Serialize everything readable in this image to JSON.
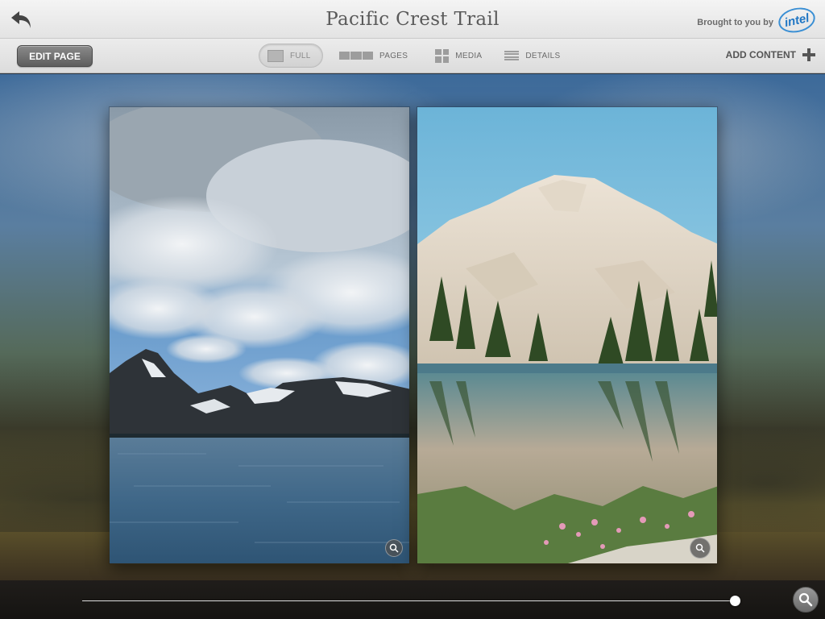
{
  "app": {
    "title": "Pacific Crest Trail",
    "sponsor_text": "Brought to you by",
    "sponsor_logo_text": "intel",
    "back_icon": "back-arrow-icon"
  },
  "toolbar": {
    "edit_label": "EDIT PAGE",
    "views": [
      {
        "label": "FULL",
        "icon": "full-view-icon",
        "active": true
      },
      {
        "label": "PAGES",
        "icon": "pages-view-icon",
        "active": false
      },
      {
        "label": "MEDIA",
        "icon": "media-grid-icon",
        "active": false
      },
      {
        "label": "DETAILS",
        "icon": "details-list-icon",
        "active": false
      }
    ],
    "add_content_label": "ADD CONTENT",
    "add_icon": "plus-icon"
  },
  "spread": {
    "left_page": {
      "photo": "mountain-lake-clouds-photo",
      "zoom_icon": "zoom-in-icon"
    },
    "right_page": {
      "photo": "granite-peak-lake-photo",
      "zoom_icon": "zoom-in-icon"
    }
  },
  "scrubber": {
    "position_fraction": 1.0,
    "search_icon": "magnifier-icon"
  },
  "colors": {
    "toolbar_bg": "#e4e4e4",
    "intel_blue": "#1f76c4",
    "edit_button": "#6e6e6e"
  }
}
